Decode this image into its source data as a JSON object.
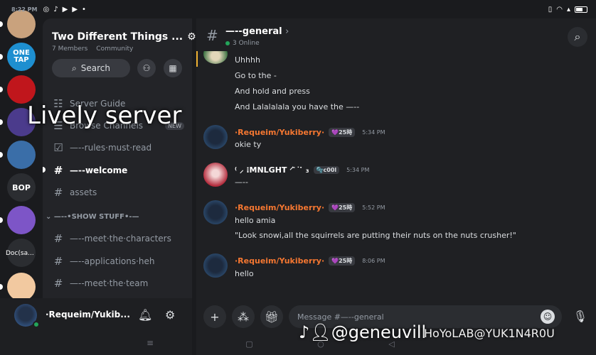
{
  "status": {
    "time": "8:22 PM",
    "left_icons": [
      "whatsapp-icon",
      "tiktok-icon",
      "youtube-icon",
      "youtube-icon",
      "dot"
    ]
  },
  "rail": {
    "servers": [
      {
        "name": "avatar-1",
        "color": "#c9a27d"
      },
      {
        "name": "onetap",
        "label": "ONE TAP",
        "color": "#1e8fd0"
      },
      {
        "name": "red-server",
        "color": "#c0161c"
      },
      {
        "name": "purple-server",
        "color": "#4b3b8c"
      },
      {
        "name": "character-server",
        "color": "#3a6ea8"
      },
      {
        "name": "bop",
        "label": "BOP",
        "color": "#2b2d31"
      },
      {
        "name": "cloud-server",
        "color": "#7d55c7"
      },
      {
        "name": "docs",
        "label": "Doc(sa...",
        "color": "#2b2d31"
      },
      {
        "name": "anime-server",
        "color": "#f2c9a0"
      }
    ]
  },
  "sidebar": {
    "guild_name": "Two Different Things ...",
    "members": "7 Members",
    "type": "Community",
    "search_label": "Search",
    "overlay": "Lively server",
    "channels": [
      {
        "name": "Server Guide",
        "icon": "☷"
      },
      {
        "name": "Browse Channels",
        "icon": "☰",
        "badge": "NEW"
      },
      {
        "name": "—--rules·must·read",
        "icon": "☑"
      },
      {
        "name": "—--welcome",
        "icon": "#",
        "active": true
      },
      {
        "name": "assets",
        "icon": "#"
      }
    ],
    "category": "—--•SHOW STUFF•-—",
    "category_channels": [
      {
        "name": "—--meet·the·characters",
        "icon": "#"
      },
      {
        "name": "—--applications·heh",
        "icon": "#"
      },
      {
        "name": "—--meet·the·team",
        "icon": "#"
      }
    ]
  },
  "user_panel": {
    "name": "·Requeim/Yukib...",
    "bell": "bell-icon",
    "gear": "gear-icon"
  },
  "channel": {
    "name": "—--general",
    "online": "3 Online"
  },
  "messages": {
    "continued": [
      "Uhhhh",
      "Go to the -",
      "And hold and press",
      "And Lalalalala you have the —--"
    ],
    "groups": [
      {
        "author": "·Requeim/Yukiberry·",
        "tag": "💜25時",
        "time": "5:34 PM",
        "lines": [
          "okie ty"
        ],
        "avatar": "blue"
      },
      {
        "author": "⁽ ⸝ ⁝MNLGHT ⸍᷅ ˙ ̇ ₃",
        "tag": "🫧c00l",
        "time": "5:34 PM",
        "lines": [
          "—--"
        ],
        "avatar": "red"
      },
      {
        "author": "·Requeim/Yukiberry·",
        "tag": "💜25時",
        "time": "5:52 PM",
        "lines": [
          "hello amia",
          "\"Look snowi,all the squirrels are putting their nuts on the nuts crusher!\""
        ],
        "avatar": "blue"
      },
      {
        "author": "·Requeim/Yukiberry·",
        "tag": "💜25時",
        "time": "8:06 PM",
        "lines": [
          "hello"
        ],
        "avatar": "blue"
      }
    ]
  },
  "composer": {
    "placeholder": "Message #—--general"
  },
  "watermark": {
    "tiktok": "@geneuvill",
    "hoyolab": "HoYoLAB@YUK1N4R0U"
  }
}
